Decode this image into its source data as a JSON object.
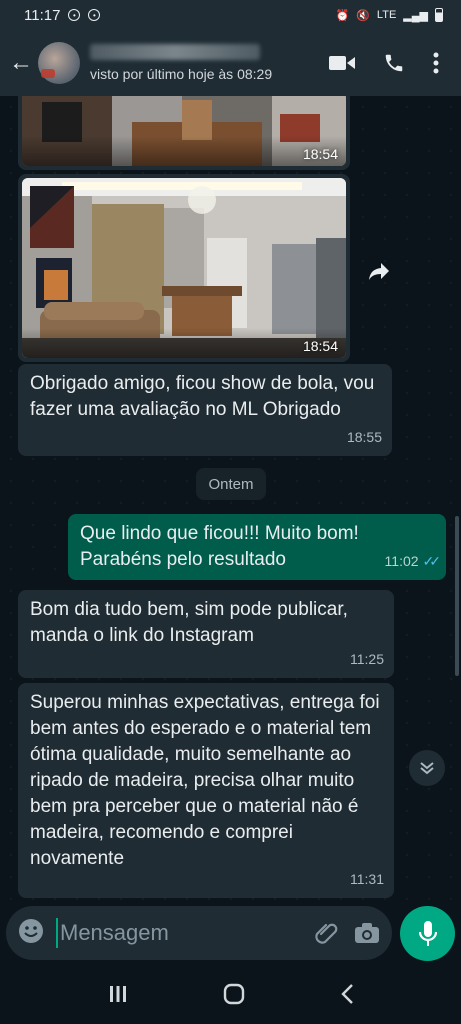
{
  "status_bar": {
    "time": "11:17",
    "network": "LTE"
  },
  "header": {
    "last_seen": "visto por último hoje às 08:29",
    "icons": [
      "back-arrow-icon",
      "video-call-icon",
      "voice-call-icon",
      "more-options-icon"
    ]
  },
  "messages": [
    {
      "type": "image",
      "direction": "in",
      "time": "18:54"
    },
    {
      "type": "image",
      "direction": "in",
      "time": "18:54"
    },
    {
      "type": "text",
      "direction": "in",
      "text": "Obrigado amigo, ficou show de bola, vou fazer uma avaliação no ML Obrigado",
      "time": "18:55"
    },
    {
      "type": "text",
      "direction": "out",
      "text": "Que lindo que ficou!!! Muito bom! Parabéns pelo resultado",
      "time": "11:02",
      "status": "read"
    },
    {
      "type": "text",
      "direction": "in",
      "text": "Bom dia tudo bem, sim pode publicar, manda o link do Instagram",
      "time": "11:25"
    },
    {
      "type": "text",
      "direction": "in",
      "text": "Superou minhas expectativas, entrega foi bem antes do esperado e o material tem ótima qualidade, muito semelhante ao ripado de madeira, precisa olhar muito bem pra perceber que o material não é madeira, recomendo e comprei novamente",
      "time": "11:31"
    }
  ],
  "day_separator": "Ontem",
  "composer": {
    "placeholder": "Mensagem"
  },
  "colors": {
    "background": "#0b141a",
    "header": "#1f2c34",
    "incoming_bubble": "#202c33",
    "outgoing_bubble": "#005c4b",
    "accent": "#00a884",
    "read_ticks": "#53bdeb"
  }
}
